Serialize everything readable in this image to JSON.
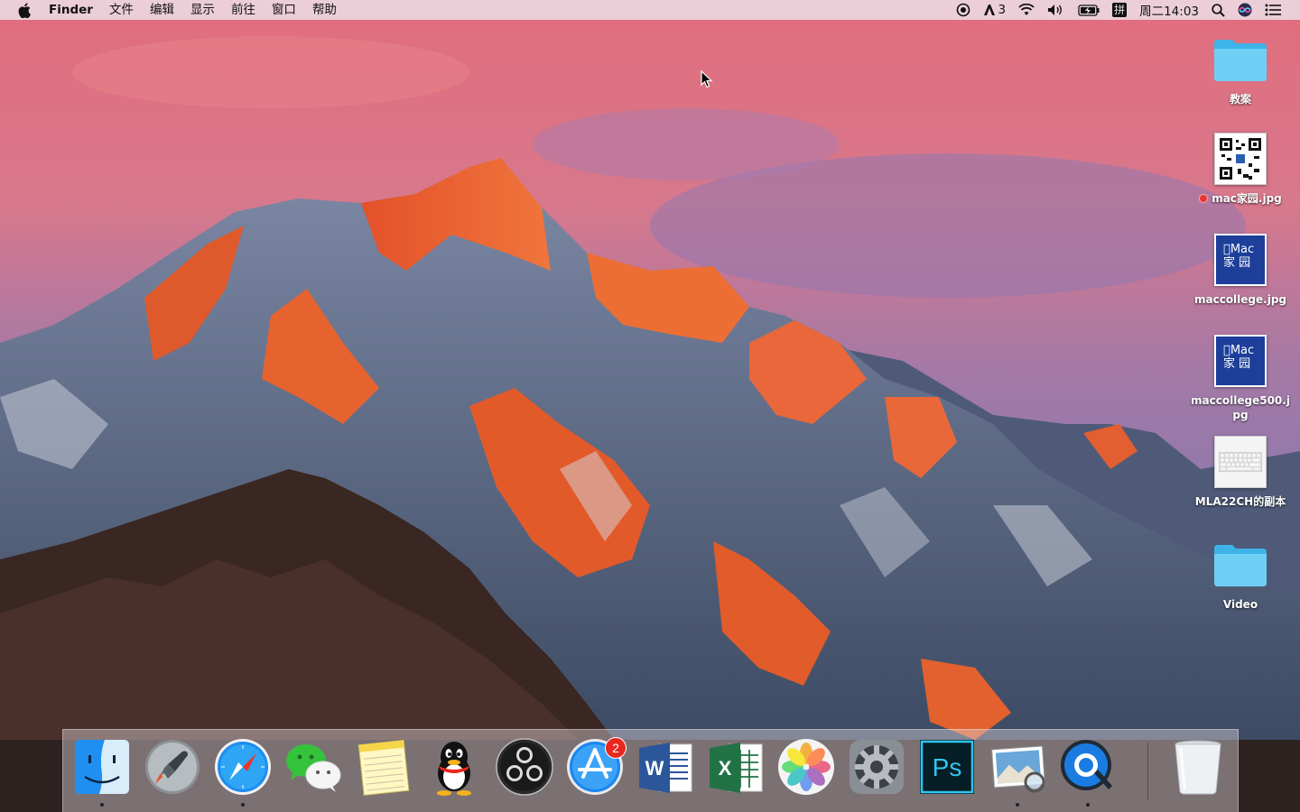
{
  "menubar": {
    "app_name": "Finder",
    "menus": [
      "文件",
      "编辑",
      "显示",
      "前往",
      "窗口",
      "帮助"
    ],
    "status": {
      "adobe_count": "3",
      "input_method": "拼",
      "clock": "周二14:03"
    }
  },
  "desktop": {
    "icons": [
      {
        "label": "教案",
        "kind": "folder"
      },
      {
        "label": "mac家园.jpg",
        "kind": "qr-image",
        "tag_color": "#e8362e"
      },
      {
        "label": "maccollege.jpg",
        "kind": "mac-image"
      },
      {
        "label": "maccollege500.jpg",
        "kind": "mac-image"
      },
      {
        "label": "MLA22CH的副本",
        "kind": "keyboard-image"
      },
      {
        "label": "Video",
        "kind": "folder"
      }
    ],
    "thumb_text": {
      "line1": "Mac",
      "line2": "家 园"
    }
  },
  "dock": {
    "apps": [
      {
        "name": "Finder",
        "icon": "finder-icon",
        "running": true
      },
      {
        "name": "Launchpad",
        "icon": "launchpad-icon",
        "running": false
      },
      {
        "name": "Safari",
        "icon": "safari-icon",
        "running": true
      },
      {
        "name": "WeChat",
        "icon": "wechat-icon",
        "running": false
      },
      {
        "name": "Notes",
        "icon": "notes-icon",
        "running": false
      },
      {
        "name": "QQ",
        "icon": "qq-icon",
        "running": false
      },
      {
        "name": "OBS",
        "icon": "obs-icon",
        "running": false
      },
      {
        "name": "App Store",
        "icon": "app-store-icon",
        "running": false,
        "badge": "2"
      },
      {
        "name": "Word",
        "icon": "word-icon",
        "running": false
      },
      {
        "name": "Excel",
        "icon": "excel-icon",
        "running": false
      },
      {
        "name": "Photos",
        "icon": "photos-icon",
        "running": false
      },
      {
        "name": "System Preferences",
        "icon": "system-preferences-icon",
        "running": false
      },
      {
        "name": "Photoshop",
        "icon": "photoshop-icon",
        "running": false
      },
      {
        "name": "Preview",
        "icon": "preview-icon",
        "running": true
      },
      {
        "name": "QuickTime Player",
        "icon": "quicktime-icon",
        "running": true
      },
      {
        "name": "Trash",
        "icon": "trash-icon",
        "running": false
      }
    ],
    "glyphs": {
      "word": "W",
      "excel": "X",
      "photoshop": "Ps",
      "appstore": "A"
    }
  },
  "colors": {
    "menubar_bg": "#ecdce4",
    "folder_blue": "#5ec8f2",
    "badge_red": "#e8271f",
    "tag_red": "#e8362e"
  }
}
